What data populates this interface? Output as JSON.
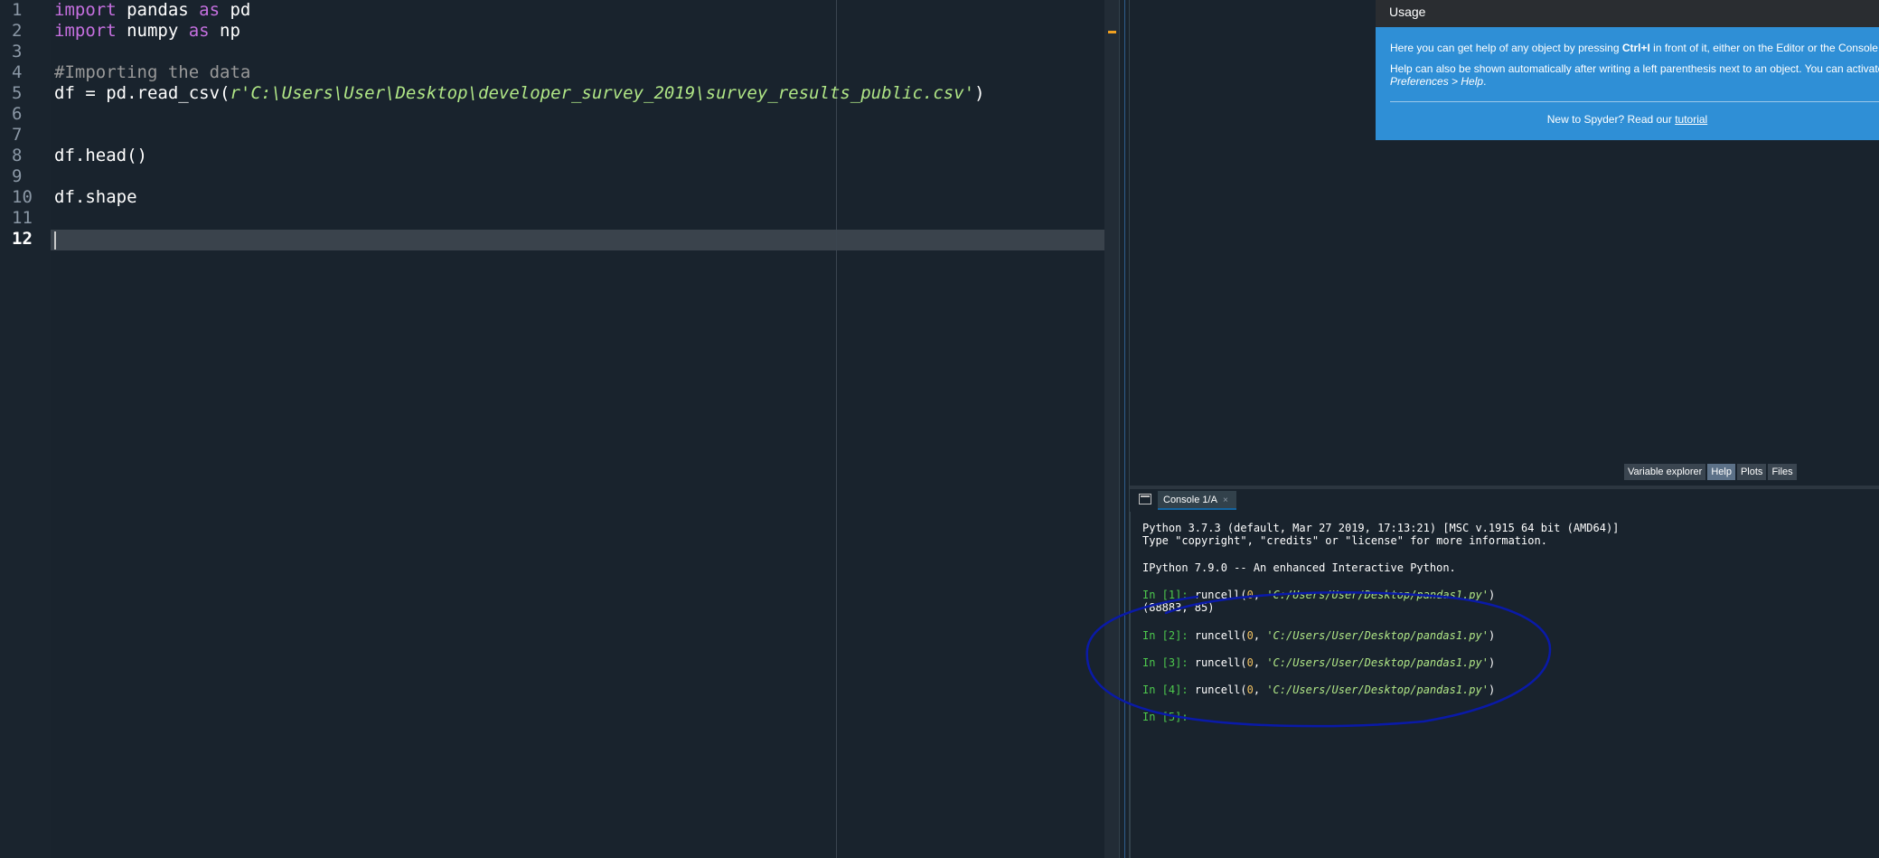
{
  "editor": {
    "line_numbers": [
      "1",
      "2",
      "3",
      "4",
      "5",
      "6",
      "7",
      "8",
      "9",
      "10",
      "11",
      "12"
    ],
    "active_line": "12",
    "lines": {
      "l1": {
        "kw1": "import",
        "t1": " pandas ",
        "kw2": "as",
        "t2": " pd"
      },
      "l2": {
        "kw1": "import",
        "t1": " numpy ",
        "kw2": "as",
        "t2": " np"
      },
      "l4": {
        "comment": "#Importing the data"
      },
      "l5": {
        "t1": "df = pd.read_csv(",
        "str": "r'C:\\Users\\User\\Desktop\\developer_survey_2019\\survey_results_public.csv'",
        "t2": ")"
      },
      "l8": {
        "t1": "df.head()"
      },
      "l10": {
        "t1": "df.shape"
      }
    }
  },
  "help": {
    "title": "Usage",
    "p1_a": "Here you can get help of any object by pressing ",
    "p1_key": "Ctrl+I",
    "p1_b": " in front of it, either on the Editor or the Console.",
    "p2_a": "Help can also be shown automatically after writing a left parenthesis next to an object. You can activate this behavior in",
    "p2_b": "Preferences > Help",
    "p2_c": ".",
    "tutorial_prefix": "New to Spyder? Read our ",
    "tutorial_link": "tutorial"
  },
  "pane_tabs": {
    "variable_explorer": "Variable explorer",
    "help": "Help",
    "plots": "Plots",
    "files": "Files",
    "active": "Help"
  },
  "console": {
    "tab_label": "Console 1/A",
    "tab_close": "×",
    "banner1": "Python 3.7.3 (default, Mar 27 2019, 17:13:21) [MSC v.1915 64 bit (AMD64)]",
    "banner2": "Type \"copyright\", \"credits\" or \"license\" for more information.",
    "banner3": "IPython 7.9.0 -- An enhanced Interactive Python.",
    "cells": [
      {
        "prompt_a": "In [",
        "n": "1",
        "prompt_b": "]: ",
        "cmd": "runcell(",
        "arg0": "0",
        "sep": ", ",
        "path": "'C:/Users/User/Desktop/pandas1.py'",
        "close": ")"
      },
      {
        "prompt_a": "In [",
        "n": "2",
        "prompt_b": "]: ",
        "cmd": "runcell(",
        "arg0": "0",
        "sep": ", ",
        "path": "'C:/Users/User/Desktop/pandas1.py'",
        "close": ")"
      },
      {
        "prompt_a": "In [",
        "n": "3",
        "prompt_b": "]: ",
        "cmd": "runcell(",
        "arg0": "0",
        "sep": ", ",
        "path": "'C:/Users/User/Desktop/pandas1.py'",
        "close": ")"
      },
      {
        "prompt_a": "In [",
        "n": "4",
        "prompt_b": "]: ",
        "cmd": "runcell(",
        "arg0": "0",
        "sep": ", ",
        "path": "'C:/Users/User/Desktop/pandas1.py'",
        "close": ")"
      }
    ],
    "output1": "(88883, 85)",
    "final_prompt": "In [5]:"
  },
  "colors": {
    "background": "#19232d",
    "keyword": "#c670e0",
    "string": "#b0e686",
    "comment": "#999999",
    "help_blue": "#2f8fd6",
    "prompt_green": "#4dc84d",
    "annotation_ink": "#0a1aa8"
  }
}
